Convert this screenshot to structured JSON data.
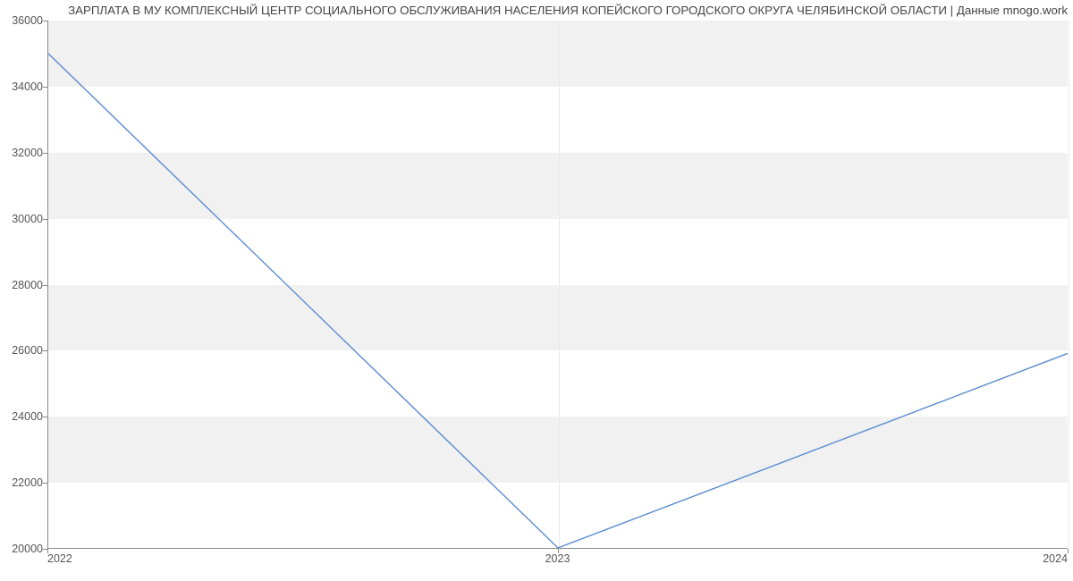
{
  "chart_data": {
    "type": "line",
    "title": "ЗАРПЛАТА В МУ КОМПЛЕКСНЫЙ ЦЕНТР СОЦИАЛЬНОГО ОБСЛУЖИВАНИЯ НАСЕЛЕНИЯ КОПЕЙСКОГО ГОРОДСКОГО ОКРУГА ЧЕЛЯБИНСКОЙ ОБЛАСТИ | Данные mnogo.work",
    "x": [
      "2022",
      "2023",
      "2024"
    ],
    "values": [
      35000,
      20000,
      25900
    ],
    "xlabel": "",
    "ylabel": "",
    "x_ticks": [
      "2022",
      "2023",
      "2024"
    ],
    "y_ticks": [
      20000,
      22000,
      24000,
      26000,
      28000,
      30000,
      32000,
      34000,
      36000
    ],
    "ylim": [
      20000,
      36000
    ],
    "xlim_index": [
      0,
      2
    ]
  }
}
